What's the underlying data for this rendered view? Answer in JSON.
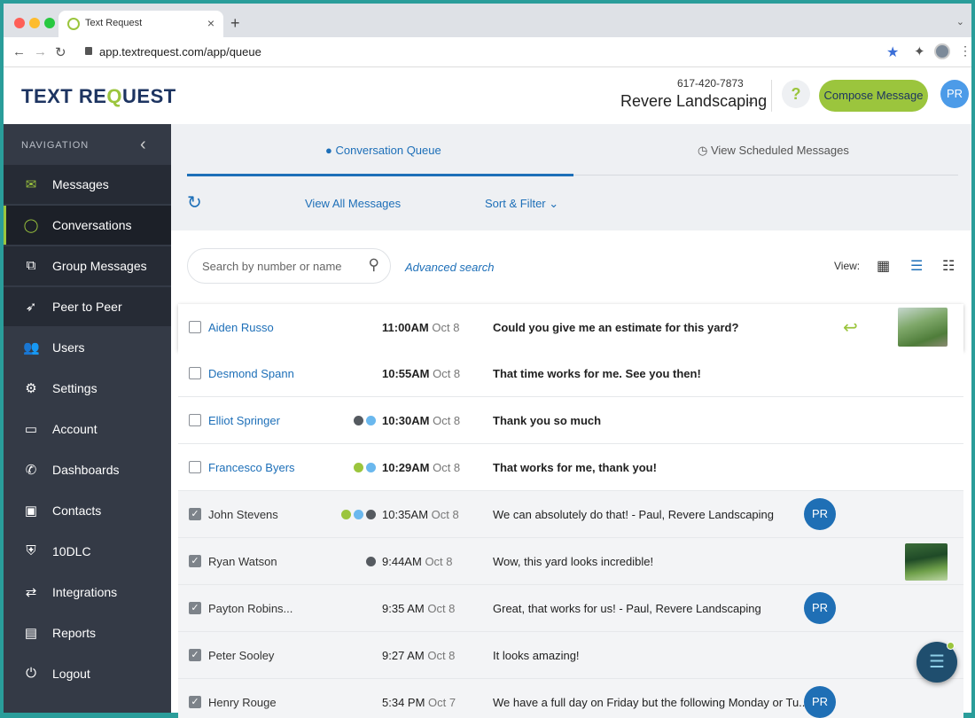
{
  "browser": {
    "tab_title": "Text Request",
    "tab_close": "×",
    "new_tab": "+",
    "tab_menu": "⌄",
    "url": "app.textrequest.com/app/queue",
    "back": "←",
    "forward": "→",
    "reload": "↻",
    "star": "★",
    "extensions": "✦",
    "menu": "⋮"
  },
  "header": {
    "logo_a": "TEXT RE",
    "logo_q": "Q",
    "logo_b": "UEST",
    "phone": "617-420-7873",
    "company": "Revere Landscaping",
    "company_chevron": "⌄",
    "help": "?",
    "compose_label": "Compose Message",
    "avatar_initials": "PR"
  },
  "sidebar": {
    "title": "NAVIGATION",
    "collapse": "‹",
    "items": [
      {
        "label": "Messages",
        "icon": "✉"
      },
      {
        "label": "Conversations",
        "icon": "◯"
      },
      {
        "label": "Group Messages",
        "icon": "⧉"
      },
      {
        "label": "Peer to Peer",
        "icon": "➶"
      },
      {
        "label": "Users",
        "icon": "👥"
      },
      {
        "label": "Settings",
        "icon": "⚙"
      },
      {
        "label": "Account",
        "icon": "▭"
      },
      {
        "label": "Dashboards",
        "icon": "✆"
      },
      {
        "label": "Contacts",
        "icon": "▣"
      },
      {
        "label": "10DLC",
        "icon": "⛨"
      },
      {
        "label": "Integrations",
        "icon": "⇄"
      },
      {
        "label": "Reports",
        "icon": "▤"
      },
      {
        "label": "Logout",
        "icon": "⏻"
      }
    ]
  },
  "main": {
    "tabs": {
      "queue_icon": "●",
      "queue_label": "Conversation Queue",
      "scheduled_icon": "◷",
      "scheduled_label": "View Scheduled Messages"
    },
    "toolbar": {
      "refresh": "↻",
      "view_all": "View All Messages",
      "sort_filter": "Sort & Filter ⌄"
    },
    "search": {
      "placeholder": "Search by number or name",
      "icon": "⚲",
      "advanced": "Advanced search"
    },
    "view": {
      "label": "View:",
      "grid_icon": "▦",
      "list_icon": "☰",
      "detail_icon": "☷"
    }
  },
  "colors": {
    "accent_green": "#9bc53d",
    "brand_blue": "#1d6fb8",
    "dot_dark": "#555a60",
    "dot_blue": "#6ab8ee"
  },
  "rows": [
    {
      "name": "Aiden Russo",
      "time": "11:00AM",
      "date": "Oct 8",
      "message": "Could you give me an estimate for this yard?",
      "unread": true,
      "checked": false,
      "dots": [],
      "reply": "↩",
      "thumb": true,
      "avatar": ""
    },
    {
      "name": "Desmond Spann",
      "time": "10:55AM",
      "date": "Oct 8",
      "message": "That time works for me. See you then!",
      "unread": true,
      "checked": false,
      "dots": [],
      "reply": "",
      "thumb": false,
      "avatar": ""
    },
    {
      "name": "Elliot Springer",
      "time": "10:30AM",
      "date": "Oct 8",
      "message": "Thank you so much",
      "unread": true,
      "checked": false,
      "dots": [
        "#555a60",
        "#6ab8ee"
      ],
      "reply": "",
      "thumb": false,
      "avatar": ""
    },
    {
      "name": "Francesco Byers",
      "time": "10:29AM",
      "date": "Oct 8",
      "message": "That works for me, thank you!",
      "unread": true,
      "checked": false,
      "dots": [
        "#9bc53d",
        "#6ab8ee"
      ],
      "reply": "",
      "thumb": false,
      "avatar": ""
    },
    {
      "name": "John Stevens",
      "time": "10:35AM",
      "date": "Oct 8",
      "message": "We can absolutely do that! - Paul, Revere Landscaping",
      "unread": false,
      "checked": true,
      "dots": [
        "#9bc53d",
        "#6ab8ee",
        "#555a60"
      ],
      "reply": "",
      "thumb": false,
      "avatar": "PR"
    },
    {
      "name": "Ryan Watson",
      "time": "9:44AM",
      "date": "Oct 8",
      "message": "Wow, this yard looks incredible!",
      "unread": false,
      "checked": true,
      "dots": [
        "#555a60"
      ],
      "reply": "",
      "thumb": true,
      "avatar": ""
    },
    {
      "name": "Payton Robins...",
      "time": "9:35 AM",
      "date": "Oct 8",
      "message": "Great, that works for us! - Paul, Revere Landscaping",
      "unread": false,
      "checked": true,
      "dots": [],
      "reply": "",
      "thumb": false,
      "avatar": "PR"
    },
    {
      "name": "Peter Sooley",
      "time": "9:27 AM",
      "date": "Oct 8",
      "message": "It looks amazing!",
      "unread": false,
      "checked": true,
      "dots": [],
      "reply": "",
      "thumb": false,
      "avatar": ""
    },
    {
      "name": "Henry Rouge",
      "time": "5:34 PM",
      "date": "Oct 7",
      "message": "We have a full day on Friday but the following Monday or Tu...",
      "unread": false,
      "checked": true,
      "dots": [],
      "reply": "",
      "thumb": false,
      "avatar": "PR"
    }
  ],
  "chat_widget_icon": "☰"
}
